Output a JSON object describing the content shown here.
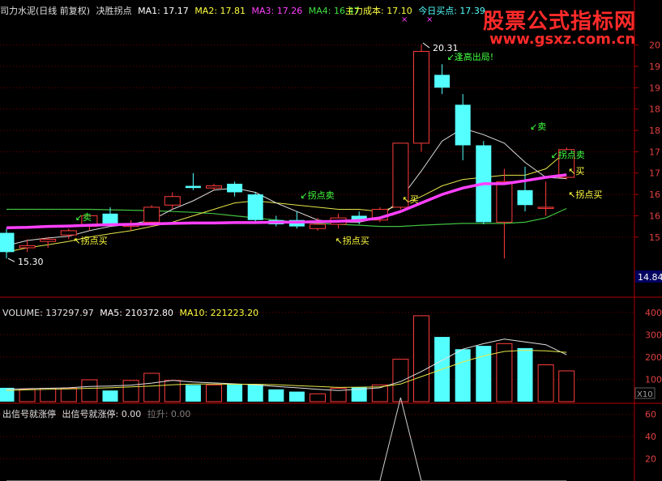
{
  "header": {
    "name": "司力水泥(日线 前复权)",
    "indicator": "决胜拐点",
    "ma1": "MA1: 17.17",
    "ma2": "MA2: 17.81",
    "ma3": "MA3: 17.26",
    "ma4": "MA4: 16.47",
    "cost": "主力成本: 17.10",
    "buy_today": "今日买点: 17.39"
  },
  "watermark": {
    "title": "股票公式指标网",
    "url": "www.gsxz.com.cn"
  },
  "price_axis": {
    "ticks": [
      "20",
      "19",
      "19",
      "18",
      "18",
      "17",
      "17",
      "16",
      "16",
      "15"
    ],
    "current": "14.84"
  },
  "annotations": {
    "high": "20.31",
    "low": "15.30",
    "escape_top": "逢高出局!",
    "sell1": "卖",
    "sell2": "拐点卖",
    "sell3": "拐点卖",
    "sell4": "卖",
    "buy1": "买",
    "buy2": "买",
    "buy_turn1": "拐点买",
    "buy_turn2": "拐点买",
    "buy_turn3": "拐点买",
    "marker_x": "×"
  },
  "volume": {
    "label": "VOLUME: 137297.97",
    "ma5": "MA5: 210372.80",
    "ma10": "MA10: 221223.20",
    "ticks": [
      "400",
      "300",
      "200",
      "100"
    ],
    "unit": "X10"
  },
  "signal": {
    "label1": "出信号就涨停",
    "label2": "出信号就涨停: 0.00",
    "rise": "拉升: 0.00",
    "ticks": [
      "60",
      "40",
      "20"
    ]
  },
  "colors": {
    "up": "#ff3c3c",
    "down": "#54ffff",
    "ma_main": "#ff40ff",
    "ma_white": "#dcdcdc",
    "ma_yellow": "#e6e64a",
    "ma_green": "#40c040"
  },
  "chart_data": {
    "type": "candlestick",
    "candles": [
      {
        "o": 15.9,
        "h": 16.0,
        "l": 15.3,
        "c": 15.45
      },
      {
        "o": 15.55,
        "h": 15.75,
        "l": 15.45,
        "c": 15.6
      },
      {
        "o": 15.7,
        "h": 15.8,
        "l": 15.55,
        "c": 15.75
      },
      {
        "o": 15.85,
        "h": 16.0,
        "l": 15.75,
        "c": 15.95
      },
      {
        "o": 16.05,
        "h": 16.3,
        "l": 15.95,
        "c": 16.3
      },
      {
        "o": 16.35,
        "h": 16.5,
        "l": 16.05,
        "c": 16.1
      },
      {
        "o": 16.05,
        "h": 16.2,
        "l": 15.95,
        "c": 16.1
      },
      {
        "o": 16.15,
        "h": 16.55,
        "l": 16.05,
        "c": 16.5
      },
      {
        "o": 16.55,
        "h": 16.85,
        "l": 16.45,
        "c": 16.75
      },
      {
        "o": 17.0,
        "h": 17.3,
        "l": 16.9,
        "c": 16.95
      },
      {
        "o": 16.95,
        "h": 17.05,
        "l": 16.9,
        "c": 17.0
      },
      {
        "o": 17.05,
        "h": 17.1,
        "l": 16.75,
        "c": 16.85
      },
      {
        "o": 16.8,
        "h": 16.85,
        "l": 16.15,
        "c": 16.2
      },
      {
        "o": 16.2,
        "h": 16.3,
        "l": 16.05,
        "c": 16.1
      },
      {
        "o": 16.2,
        "h": 16.4,
        "l": 16.0,
        "c": 16.05
      },
      {
        "o": 16.0,
        "h": 16.25,
        "l": 15.95,
        "c": 16.1
      },
      {
        "o": 16.1,
        "h": 16.35,
        "l": 16.0,
        "c": 16.25
      },
      {
        "o": 16.3,
        "h": 16.4,
        "l": 16.1,
        "c": 16.2
      },
      {
        "o": 16.2,
        "h": 16.5,
        "l": 16.15,
        "c": 16.45
      },
      {
        "o": 16.5,
        "h": 18.0,
        "l": 16.45,
        "c": 18.0
      },
      {
        "o": 18.0,
        "h": 20.31,
        "l": 17.8,
        "c": 20.15
      },
      {
        "o": 19.6,
        "h": 19.85,
        "l": 19.15,
        "c": 19.3
      },
      {
        "o": 18.9,
        "h": 19.15,
        "l": 17.6,
        "c": 17.95
      },
      {
        "o": 17.95,
        "h": 18.05,
        "l": 16.1,
        "c": 16.15
      },
      {
        "o": 16.15,
        "h": 17.4,
        "l": 15.3,
        "c": 17.1
      },
      {
        "o": 16.9,
        "h": 17.45,
        "l": 16.4,
        "c": 16.55
      },
      {
        "o": 16.5,
        "h": 17.1,
        "l": 16.3,
        "c": 16.5
      },
      {
        "o": 17.2,
        "h": 17.9,
        "l": 17.15,
        "c": 17.85
      }
    ],
    "volume": [
      62,
      55,
      60,
      60,
      98,
      50,
      95,
      127,
      95,
      75,
      75,
      78,
      78,
      55,
      45,
      35,
      60,
      65,
      75,
      190,
      385,
      290,
      235,
      250,
      260,
      240,
      165,
      138
    ],
    "vol_ma5": [
      55,
      58,
      60,
      62,
      68,
      70,
      74,
      83,
      95,
      88,
      84,
      80,
      75,
      68,
      62,
      55,
      50,
      55,
      62,
      90,
      135,
      185,
      235,
      260,
      280,
      268,
      255,
      210
    ],
    "vol_ma10": [
      50,
      53,
      55,
      57,
      60,
      62,
      66,
      70,
      76,
      79,
      79,
      78,
      78,
      76,
      72,
      68,
      64,
      65,
      66,
      79,
      112,
      145,
      178,
      205,
      225,
      230,
      228,
      221
    ],
    "ma_main": [
      16.02,
      16.03,
      16.05,
      16.06,
      16.08,
      16.09,
      16.1,
      16.11,
      16.12,
      16.13,
      16.13,
      16.14,
      16.14,
      16.15,
      16.15,
      16.16,
      16.17,
      16.19,
      16.25,
      16.4,
      16.6,
      16.8,
      16.95,
      17.05,
      17.05,
      17.12,
      17.2,
      17.26
    ],
    "ma_white": [
      15.6,
      15.72,
      15.78,
      15.82,
      15.95,
      16.05,
      16.1,
      16.2,
      16.45,
      16.65,
      16.9,
      16.95,
      16.85,
      16.6,
      16.4,
      16.2,
      16.15,
      16.15,
      16.25,
      16.7,
      17.35,
      18.05,
      18.35,
      18.2,
      18.0,
      17.55,
      17.2,
      17.17
    ],
    "ma_yellow": [
      15.45,
      15.55,
      15.62,
      15.7,
      15.8,
      15.88,
      15.95,
      16.05,
      16.15,
      16.3,
      16.45,
      16.6,
      16.65,
      16.6,
      16.55,
      16.5,
      16.45,
      16.45,
      16.4,
      16.55,
      16.75,
      17.0,
      17.15,
      17.2,
      17.25,
      17.25,
      17.4,
      17.81
    ],
    "ma_green": [
      16.45,
      16.45,
      16.45,
      16.45,
      16.45,
      16.44,
      16.43,
      16.42,
      16.4,
      16.38,
      16.35,
      16.3,
      16.25,
      16.2,
      16.15,
      16.12,
      16.1,
      16.08,
      16.05,
      16.05,
      16.08,
      16.1,
      16.12,
      16.12,
      16.12,
      16.15,
      16.25,
      16.47
    ],
    "signal": [
      0,
      0,
      0,
      0,
      0,
      0,
      0,
      0,
      0,
      0,
      0,
      0,
      0,
      0,
      0,
      0,
      0,
      0,
      0,
      75,
      0,
      0,
      0,
      0,
      0,
      0,
      0,
      0
    ]
  }
}
